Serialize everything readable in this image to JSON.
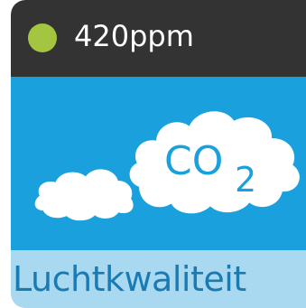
{
  "widget": {
    "reading": "420ppm",
    "status_color": "#a4c53f",
    "gas_label_main": "CO",
    "gas_label_sub": "2",
    "title": "Luchtkwaliteit"
  },
  "colors": {
    "header_bg": "#333333",
    "illustration_bg": "#1aa1dd",
    "footer_bg": "#a9d9f0",
    "footer_text": "#1a7bb3",
    "cloud_fill": "#ffffff",
    "cloud_text": "#1aa1dd"
  },
  "icons": {
    "status": "status-dot-icon",
    "large_cloud": "co2-cloud-icon",
    "small_cloud": "small-cloud-icon"
  }
}
